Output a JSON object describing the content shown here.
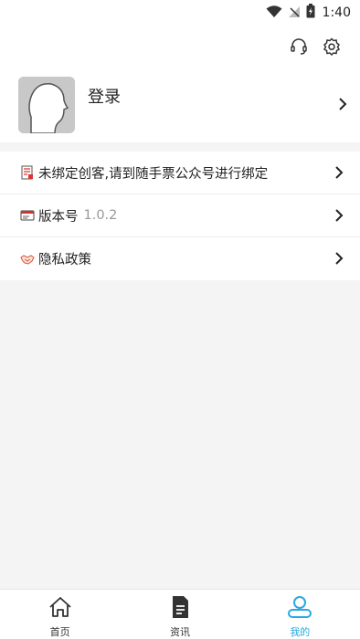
{
  "status_bar": {
    "time": "1:40",
    "icons": [
      "wifi-icon",
      "no-signal-icon",
      "battery-charging-icon"
    ]
  },
  "top_actions": {
    "icons": [
      "headset-icon",
      "settings-gear-icon"
    ]
  },
  "profile": {
    "login_label": "登录",
    "avatar_icon": "default-avatar-silhouette"
  },
  "menu": {
    "items": [
      {
        "icon": "document-icon",
        "label": "未绑定创客,请到随手票公众号进行绑定",
        "value": ""
      },
      {
        "icon": "id-card-icon",
        "label": "版本号",
        "value": "1.0.2"
      },
      {
        "icon": "handshake-icon",
        "label": "隐私政策",
        "value": ""
      }
    ]
  },
  "tabbar": {
    "tabs": [
      {
        "label": "首页",
        "icon": "home-icon",
        "active": false
      },
      {
        "label": "资讯",
        "icon": "news-document-icon",
        "active": false
      },
      {
        "label": "我的",
        "icon": "user-profile-icon",
        "active": true
      }
    ]
  },
  "colors": {
    "accent": "#29a9e0",
    "background": "#f4f4f4"
  }
}
